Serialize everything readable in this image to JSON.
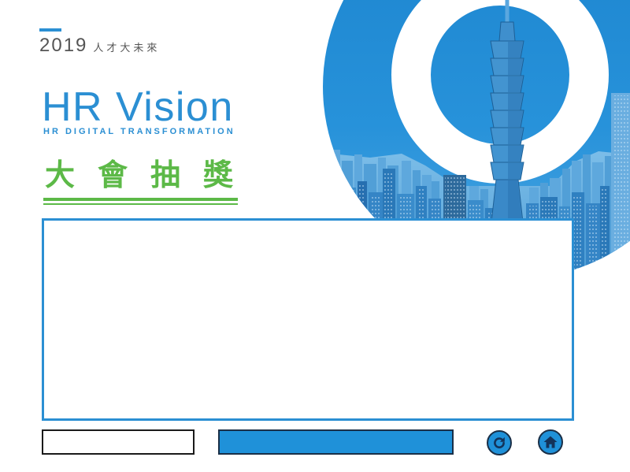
{
  "header": {
    "year": "2019",
    "tagline": "人才大未來"
  },
  "logo": {
    "title": "HR Vision",
    "subtitle": "HR DIGITAL TRANSFORMATION"
  },
  "event": {
    "title": "大會抽獎"
  },
  "controls": {
    "input_value": "",
    "refresh_button_icon": "refresh-icon",
    "home_button_icon": "home-icon"
  },
  "colors": {
    "brand_blue": "#2b8fd3",
    "button_fill": "#1f91d9",
    "accent_green": "#5cb947",
    "text_gray": "#555555",
    "control_border": "#1a2f47"
  }
}
